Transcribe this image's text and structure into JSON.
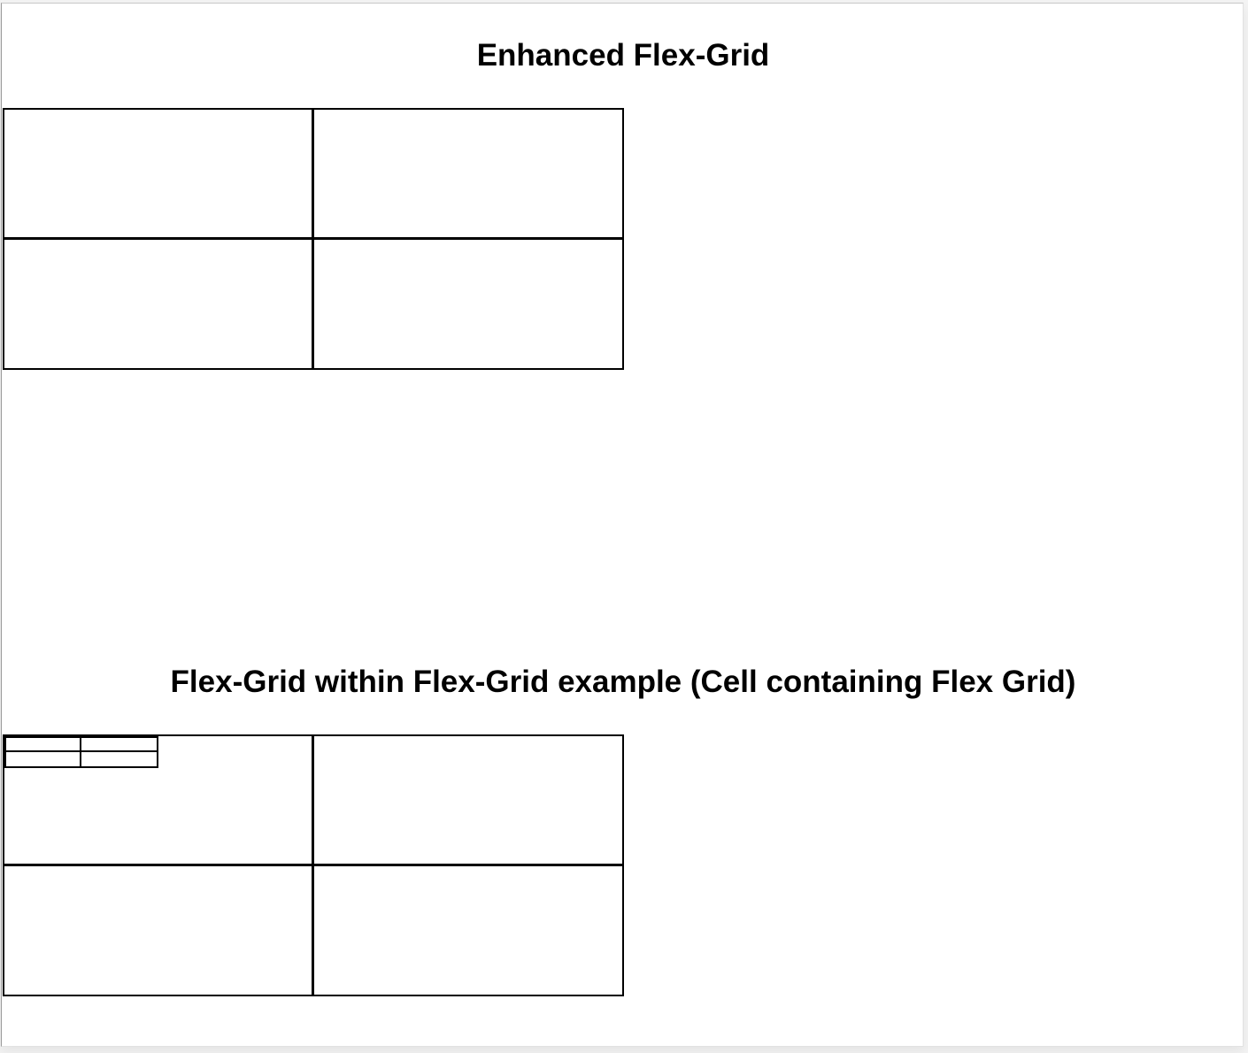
{
  "sections": [
    {
      "heading": "Enhanced Flex-Grid",
      "grid": {
        "rows": 2,
        "columns": 2
      }
    },
    {
      "heading": "Flex-Grid within Flex-Grid example (Cell containing Flex Grid)",
      "grid": {
        "rows": 2,
        "columns": 2,
        "nested_grid_in_cell": "top-left",
        "nested_grid": {
          "rows": 2,
          "columns": 2
        }
      }
    }
  ]
}
